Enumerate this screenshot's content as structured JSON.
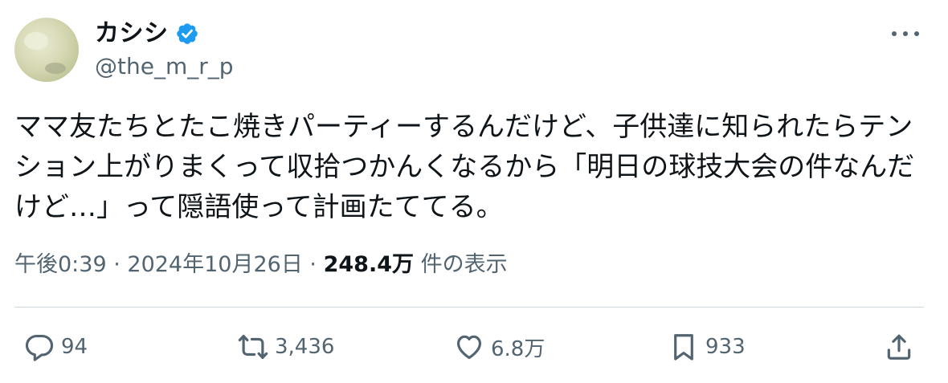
{
  "author": {
    "display_name": "カシシ",
    "handle": "@the_m_r_p",
    "verified": true
  },
  "tweet": {
    "text": "ママ友たちとたこ焼きパーティーするんだけど、子供達に知られたらテン\nション上がりまくって収拾つかんくなるから「明日の球技大会の件なんだ\nけど…」って隠語使って計画たててる。"
  },
  "meta": {
    "time": "午後0:39",
    "sep1": " · ",
    "date": "2024年10月26日",
    "sep2": " · ",
    "views_count": "248.4万",
    "views_label": " 件の表示"
  },
  "actions": {
    "reply_count": "94",
    "retweet_count": "3,436",
    "like_count": "6.8万",
    "bookmark_count": "933"
  },
  "icons": {
    "verified": "verified-badge-icon",
    "more": "more-horizontal-icon",
    "reply": "reply-icon",
    "retweet": "retweet-icon",
    "like": "heart-icon",
    "bookmark": "bookmark-icon",
    "share": "share-icon"
  },
  "colors": {
    "text": "#0f1419",
    "secondary": "#536471",
    "verified": "#1d9bf0",
    "divider": "#cfd9de"
  }
}
